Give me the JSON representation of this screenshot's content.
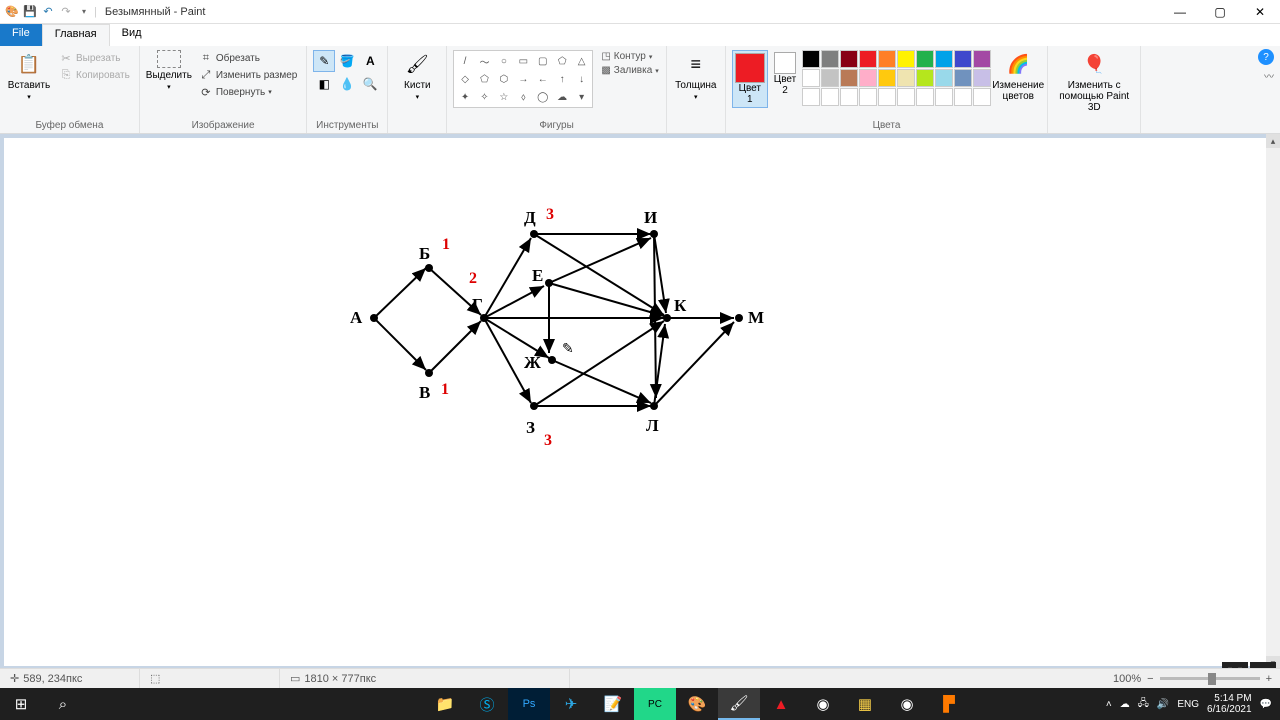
{
  "title": "Безымянный - Paint",
  "menu": {
    "file": "File",
    "home": "Главная",
    "view": "Вид"
  },
  "clipboard": {
    "paste": "Вставить",
    "cut": "Вырезать",
    "copy": "Копировать",
    "group": "Буфер обмена"
  },
  "image": {
    "select": "Выделить",
    "crop": "Обрезать",
    "resize": "Изменить размер",
    "rotate": "Повернуть",
    "group": "Изображение"
  },
  "tools": {
    "group": "Инструменты"
  },
  "brushes": {
    "label": "Кисти"
  },
  "shapes": {
    "outline": "Контур",
    "fill": "Заливка",
    "group": "Фигуры"
  },
  "size": {
    "label": "Толщина"
  },
  "colors": {
    "c1": "Цвет\n1",
    "c2": "Цвет\n2",
    "edit": "Изменение\nцветов",
    "group": "Цвета"
  },
  "paint3d": {
    "label": "Изменить с\nпомощью Paint 3D"
  },
  "status": {
    "pos": "589, 234пкс",
    "dim": "1810 × 777пкс",
    "zoom": "100%"
  },
  "graph": {
    "nodes": {
      "A": "А",
      "B": "Б",
      "V": "В",
      "G": "Г",
      "D": "Д",
      "E": "Е",
      "Zh": "Ж",
      "Z": "З",
      "I": "И",
      "K": "К",
      "L": "Л",
      "M": "М"
    },
    "annotations": {
      "b": "1",
      "v": "1",
      "g": "2",
      "d": "3",
      "z": "3"
    }
  },
  "tray": {
    "lang": "ENG",
    "time": "5:14 PM",
    "date": "6/16/2021"
  },
  "palette_row1": [
    "#000000",
    "#7f7f7f",
    "#880015",
    "#ed1c24",
    "#ff7f27",
    "#fff200",
    "#22b14c",
    "#00a2e8",
    "#3f48cc",
    "#a349a4"
  ],
  "palette_row2": [
    "#ffffff",
    "#c3c3c3",
    "#b97a57",
    "#ffaec9",
    "#ffc90e",
    "#efe4b0",
    "#b5e61d",
    "#99d9ea",
    "#7092be",
    "#c8bfe7"
  ]
}
